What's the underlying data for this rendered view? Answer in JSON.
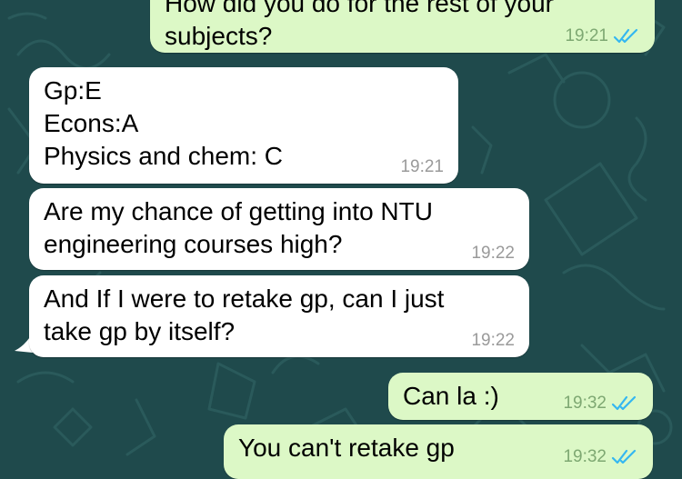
{
  "colors": {
    "wallpaper": "#1f4a4c",
    "incoming_bubble": "#ffffff",
    "outgoing_bubble": "#dcf8c6",
    "read_ticks": "#34b7f1"
  },
  "messages": [
    {
      "direction": "outgoing",
      "text": "How did you do for the rest of your\nsubjects?",
      "time": "19:21",
      "status": "read"
    },
    {
      "direction": "incoming",
      "text": "Gp:E\nEcons:A\nPhysics and chem: C",
      "time": "19:21"
    },
    {
      "direction": "incoming",
      "text": "Are my chance of getting into NTU\nengineering courses high?",
      "time": "19:22"
    },
    {
      "direction": "incoming",
      "text": "And If I were to retake gp, can I just\ntake gp by itself?",
      "time": "19:22"
    },
    {
      "direction": "outgoing",
      "text": "Can la :)",
      "time": "19:32",
      "status": "read"
    },
    {
      "direction": "outgoing",
      "text": "You can't retake gp",
      "time": "19:32",
      "status": "read"
    }
  ]
}
